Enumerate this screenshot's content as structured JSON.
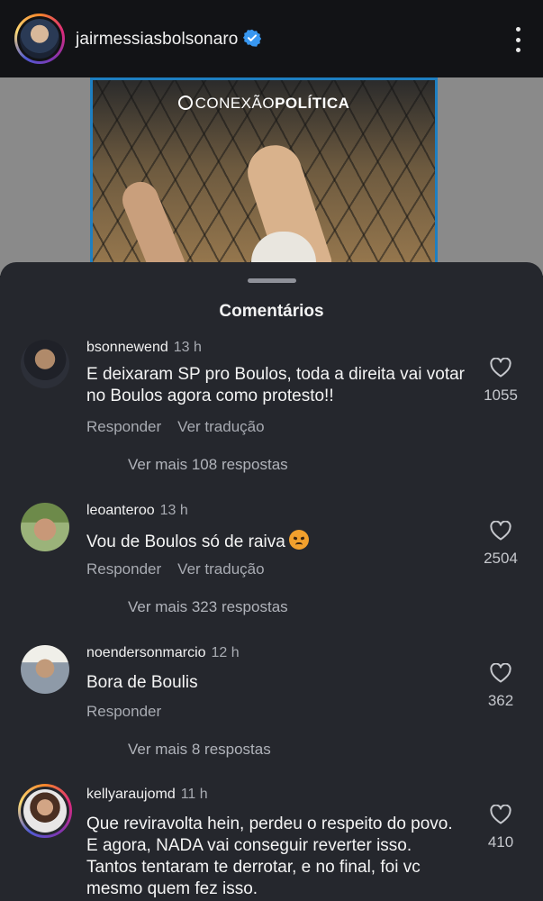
{
  "post": {
    "username": "jairmessiasbolsonaro",
    "verified": true,
    "image_brand": {
      "prefix": "CONEXÃO",
      "suffix": "POLÍTICA"
    }
  },
  "sheet": {
    "title": "Comentários"
  },
  "comments": [
    {
      "username": "bsonnewend",
      "time": "13 h",
      "text": "E deixaram SP pro Boulos, toda a direita vai votar no Boulos agora como protesto!!",
      "reply_label": "Responder",
      "translate_label": "Ver tradução",
      "likes": "1055",
      "more_replies": "Ver mais 108 respostas"
    },
    {
      "username": "leoanteroo",
      "time": "13 h",
      "text": "Vou de Boulos só de raiva",
      "emoji": "angry-face",
      "reply_label": "Responder",
      "translate_label": "Ver tradução",
      "likes": "2504",
      "more_replies": "Ver mais 323 respostas"
    },
    {
      "username": "noendersonmarcio",
      "time": "12 h",
      "text": "Bora de Boulis",
      "reply_label": "Responder",
      "likes": "362",
      "more_replies": "Ver mais 8 respostas"
    },
    {
      "username": "kellyaraujomd",
      "time": "11 h",
      "text": "Que reviravolta hein, perdeu o respeito do povo. E agora, NADA vai conseguir reverter isso. Tantos tentaram te derrotar, e no final, foi vc mesmo quem fez isso.",
      "likes": "410"
    }
  ],
  "colors": {
    "sheet_bg": "#25272d",
    "verified_blue": "#3897f0",
    "muted_text": "#a8abb2"
  }
}
